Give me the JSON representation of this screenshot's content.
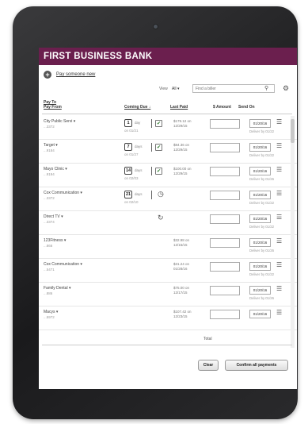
{
  "app": {
    "title": "FIRST BUSINESS BANK"
  },
  "actions": {
    "pay_someone_new": "Pay someone new"
  },
  "filters": {
    "view_label": "View",
    "view_value": "All ▾",
    "search_placeholder": "Find a biller"
  },
  "columns": {
    "pay_to": "Pay To",
    "pay_from": "Pay From",
    "coming_due": "Coming Due ↓",
    "last_paid": "Last Paid",
    "amount": "$ Amount",
    "send_on": "Send On"
  },
  "rows": [
    {
      "name": "City Public Servi ▾",
      "acct": "...3372",
      "days": "1",
      "days_unit": "day",
      "due_on": "on 01/21",
      "last_paid": "$179.12 on\n12/29/15",
      "send_on": "01/20/16",
      "deliver_by": "Deliver by 01/22",
      "icon": "ebill"
    },
    {
      "name": "Target ▾",
      "acct": "...9184",
      "days": "7",
      "days_unit": "days",
      "due_on": "on 01/27",
      "last_paid": "$84.36 on\n12/29/15",
      "send_on": "01/20/16",
      "deliver_by": "Deliver by 01/22",
      "icon": "ebill"
    },
    {
      "name": "Mayo Clinic ▾",
      "acct": "...9194",
      "days": "14",
      "days_unit": "days",
      "due_on": "on 02/03",
      "last_paid": "$100.00 on\n12/29/15",
      "send_on": "01/20/16",
      "deliver_by": "Deliver by 01/26",
      "icon": "ebill"
    },
    {
      "name": "Cox Communication ▾",
      "acct": "...3372",
      "days": "21",
      "days_unit": "days",
      "due_on": "on 02/10",
      "last_paid": "",
      "send_on": "01/20/16",
      "deliver_by": "Deliver by 01/22",
      "icon": "clock"
    },
    {
      "name": "Direct TV ▾",
      "acct": "...3374",
      "days": "",
      "days_unit": "",
      "due_on": "",
      "last_paid": "",
      "send_on": "01/20/16",
      "deliver_by": "Deliver by 01/22",
      "icon": "refresh"
    },
    {
      "name": "123Fitness ▾",
      "acct": "...866",
      "days": "",
      "days_unit": "",
      "due_on": "",
      "last_paid": "$32.98 on\n12/15/15",
      "send_on": "01/20/16",
      "deliver_by": "Deliver by 01/26",
      "icon": ""
    },
    {
      "name": "Cox Communication ▾",
      "acct": "...5471",
      "days": "",
      "days_unit": "",
      "due_on": "",
      "last_paid": "$31.24 on\n01/28/16",
      "send_on": "01/20/16",
      "deliver_by": "Deliver by 01/22",
      "icon": ""
    },
    {
      "name": "Family Dental ▾",
      "acct": "...886",
      "days": "",
      "days_unit": "",
      "due_on": "",
      "last_paid": "$75.00 on\n12/17/15",
      "send_on": "01/20/16",
      "deliver_by": "Deliver by 01/26",
      "icon": ""
    },
    {
      "name": "Macys ▾",
      "acct": "...5972",
      "days": "",
      "days_unit": "",
      "due_on": "",
      "last_paid": "$107.42 on\n12/23/15",
      "send_on": "01/20/16",
      "deliver_by": "",
      "icon": ""
    }
  ],
  "footer": {
    "total_label": "Total",
    "clear_label": "Clear",
    "confirm_label": "Confirm all payments"
  },
  "colors": {
    "brand": "#6b1f4e"
  }
}
